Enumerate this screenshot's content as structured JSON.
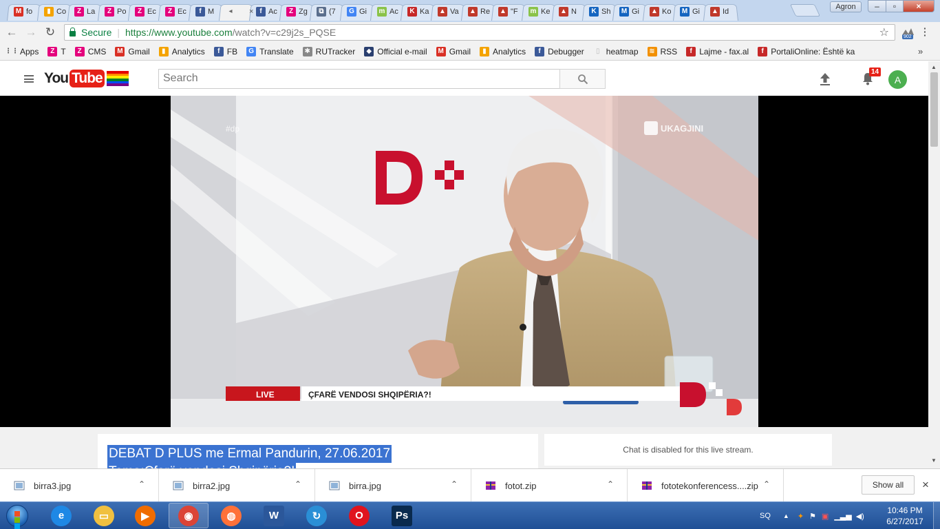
{
  "browser": {
    "tabs": [
      {
        "title": "fo",
        "icon": "gmail-icon",
        "color": "#d93025",
        "glyph": "M"
      },
      {
        "title": "Co",
        "icon": "analytics-icon",
        "color": "#f4a300",
        "glyph": "▮"
      },
      {
        "title": "La",
        "icon": "z-icon",
        "color": "#e4007c",
        "glyph": "Z"
      },
      {
        "title": "Po",
        "icon": "z-icon",
        "color": "#e4007c",
        "glyph": "Z"
      },
      {
        "title": "Ec",
        "icon": "z-icon",
        "color": "#e4007c",
        "glyph": "Z"
      },
      {
        "title": "Ec",
        "icon": "z-icon",
        "color": "#e4007c",
        "glyph": "Z"
      },
      {
        "title": "M",
        "icon": "facebook-icon",
        "color": "#3b5998",
        "glyph": "f"
      },
      {
        "title": "",
        "icon": "speaker-icon",
        "color": "#666666",
        "glyph": "◂",
        "active": true
      },
      {
        "title": "Ac",
        "icon": "facebook-icon",
        "color": "#3b5998",
        "glyph": "f"
      },
      {
        "title": "Zg",
        "icon": "z-icon",
        "color": "#e4007c",
        "glyph": "Z"
      },
      {
        "title": "(7",
        "icon": "page-icon",
        "color": "#5a6e8c",
        "glyph": "⧉"
      },
      {
        "title": "Gi",
        "icon": "translate-icon",
        "color": "#4285f4",
        "glyph": "G"
      },
      {
        "title": "Ac",
        "icon": "m-green-icon",
        "color": "#8bc34a",
        "glyph": "m"
      },
      {
        "title": "Ka",
        "icon": "k-icon",
        "color": "#c62828",
        "glyph": "K"
      },
      {
        "title": "Va",
        "icon": "flag-icon",
        "color": "#c0392b",
        "glyph": "▲"
      },
      {
        "title": "Re",
        "icon": "flag-icon",
        "color": "#c0392b",
        "glyph": "▲"
      },
      {
        "title": "\"F",
        "icon": "flag-icon",
        "color": "#c0392b",
        "glyph": "▲"
      },
      {
        "title": "Ke",
        "icon": "m-green-icon",
        "color": "#8bc34a",
        "glyph": "m"
      },
      {
        "title": "N",
        "icon": "flag-icon",
        "color": "#c0392b",
        "glyph": "▲"
      },
      {
        "title": "Sh",
        "icon": "k-blue-icon",
        "color": "#1565c0",
        "glyph": "K"
      },
      {
        "title": "Gi",
        "icon": "m-blue-icon",
        "color": "#1565c0",
        "glyph": "M"
      },
      {
        "title": "Ko",
        "icon": "flag-icon",
        "color": "#c0392b",
        "glyph": "▲"
      },
      {
        "title": "Gi",
        "icon": "m-blue-icon",
        "color": "#1565c0",
        "glyph": "M"
      },
      {
        "title": "Id",
        "icon": "flag-icon",
        "color": "#c0392b",
        "glyph": "▲"
      }
    ],
    "profile_name": "Agron",
    "close_glyph": "×",
    "url": {
      "secure_label": "Secure",
      "host": "https://www.youtube.com",
      "path": "/watch?v=c29j2s_PQSE"
    },
    "extension_badge": "902",
    "bookmarks": [
      {
        "label": "Apps",
        "icon": "apps-grid-icon",
        "color": "#555555",
        "glyph": "⋮⋮"
      },
      {
        "label": "T",
        "icon": "z-icon",
        "color": "#e4007c",
        "glyph": "Z"
      },
      {
        "label": "CMS",
        "icon": "z-icon",
        "color": "#e4007c",
        "glyph": "Z"
      },
      {
        "label": "Gmail",
        "icon": "gmail-icon",
        "color": "#d93025",
        "glyph": "M"
      },
      {
        "label": "Analytics",
        "icon": "analytics-icon",
        "color": "#f4a300",
        "glyph": "▮"
      },
      {
        "label": "FB",
        "icon": "facebook-icon",
        "color": "#3b5998",
        "glyph": "f"
      },
      {
        "label": "Translate",
        "icon": "translate-icon",
        "color": "#4285f4",
        "glyph": "G"
      },
      {
        "label": "RUTracker",
        "icon": "gear-icon",
        "color": "#888888",
        "glyph": "✱"
      },
      {
        "label": "Official e-mail",
        "icon": "shield-icon",
        "color": "#2a3f6f",
        "glyph": "◆"
      },
      {
        "label": "Gmail",
        "icon": "gmail-icon",
        "color": "#d93025",
        "glyph": "M"
      },
      {
        "label": "Analytics",
        "icon": "analytics-icon",
        "color": "#f4a300",
        "glyph": "▮"
      },
      {
        "label": "Debugger",
        "icon": "facebook-icon",
        "color": "#3b5998",
        "glyph": "f"
      },
      {
        "label": "heatmap",
        "icon": "page-icon",
        "color": "#bbbbbb",
        "glyph": "▯"
      },
      {
        "label": "RSS",
        "icon": "rss-icon",
        "color": "#f29000",
        "glyph": "≋"
      },
      {
        "label": "Lajme - fax.al",
        "icon": "f-red-icon",
        "color": "#c62828",
        "glyph": "f"
      },
      {
        "label": "PortaliOnline: Është ka",
        "icon": "f-red-icon",
        "color": "#c62828",
        "glyph": "f"
      }
    ],
    "bookmarks_more": "»"
  },
  "youtube": {
    "logo_you": "You",
    "logo_tube": "Tube",
    "rainbow_colors": [
      "#e40303",
      "#ff8c00",
      "#ffed00",
      "#008026",
      "#004dff",
      "#750787"
    ],
    "search_placeholder": "Search",
    "notification_count": "14",
    "avatar_letter": "A",
    "video": {
      "watermark_left": "#dp",
      "watermark_right": "UKAGJINI",
      "studio_logo": "D+",
      "live_label": "LIVE",
      "headline": "ÇFARË VENDOSI SHQIPËRIA?!",
      "colors": {
        "brand_red": "#c8102e",
        "live_red": "#c8161d"
      }
    },
    "title_line1": "DEBAT D PLUS me Ermal Pandurin, 27.06.2017",
    "title_line2": "Tema:Çfarë vendosi Shqipëria?!",
    "chat_disabled": "Chat is disabled for this live stream."
  },
  "downloads": {
    "items": [
      {
        "name": "birra3.jpg",
        "icon": "image-file-icon"
      },
      {
        "name": "birra2.jpg",
        "icon": "image-file-icon"
      },
      {
        "name": "birra.jpg",
        "icon": "image-file-icon"
      },
      {
        "name": "fotot.zip",
        "icon": "archive-icon"
      },
      {
        "name": "fototekonferencess....zip",
        "icon": "archive-icon"
      }
    ],
    "show_all": "Show all",
    "close": "×"
  },
  "taskbar": {
    "apps": [
      {
        "name": "internet-explorer-icon",
        "glyph": "e",
        "color": "#1e88e5"
      },
      {
        "name": "explorer-folder-icon",
        "glyph": "▭",
        "color": "#f0c040"
      },
      {
        "name": "media-player-icon",
        "glyph": "▶",
        "color": "#ef6c00"
      },
      {
        "name": "chrome-icon",
        "glyph": "◉",
        "color": "#db4437",
        "active": true
      },
      {
        "name": "firefox-icon",
        "glyph": "◍",
        "color": "#ff7139"
      },
      {
        "name": "word-icon",
        "glyph": "W",
        "color": "#2b579a"
      },
      {
        "name": "refresh-app-icon",
        "glyph": "↻",
        "color": "#2a8fd6"
      },
      {
        "name": "opera-icon",
        "glyph": "O",
        "color": "#e0141e"
      },
      {
        "name": "photoshop-icon",
        "glyph": "Ps",
        "color": "#0a2a4d"
      }
    ],
    "language": "SQ",
    "time": "10:46 PM",
    "date": "6/27/2017"
  }
}
